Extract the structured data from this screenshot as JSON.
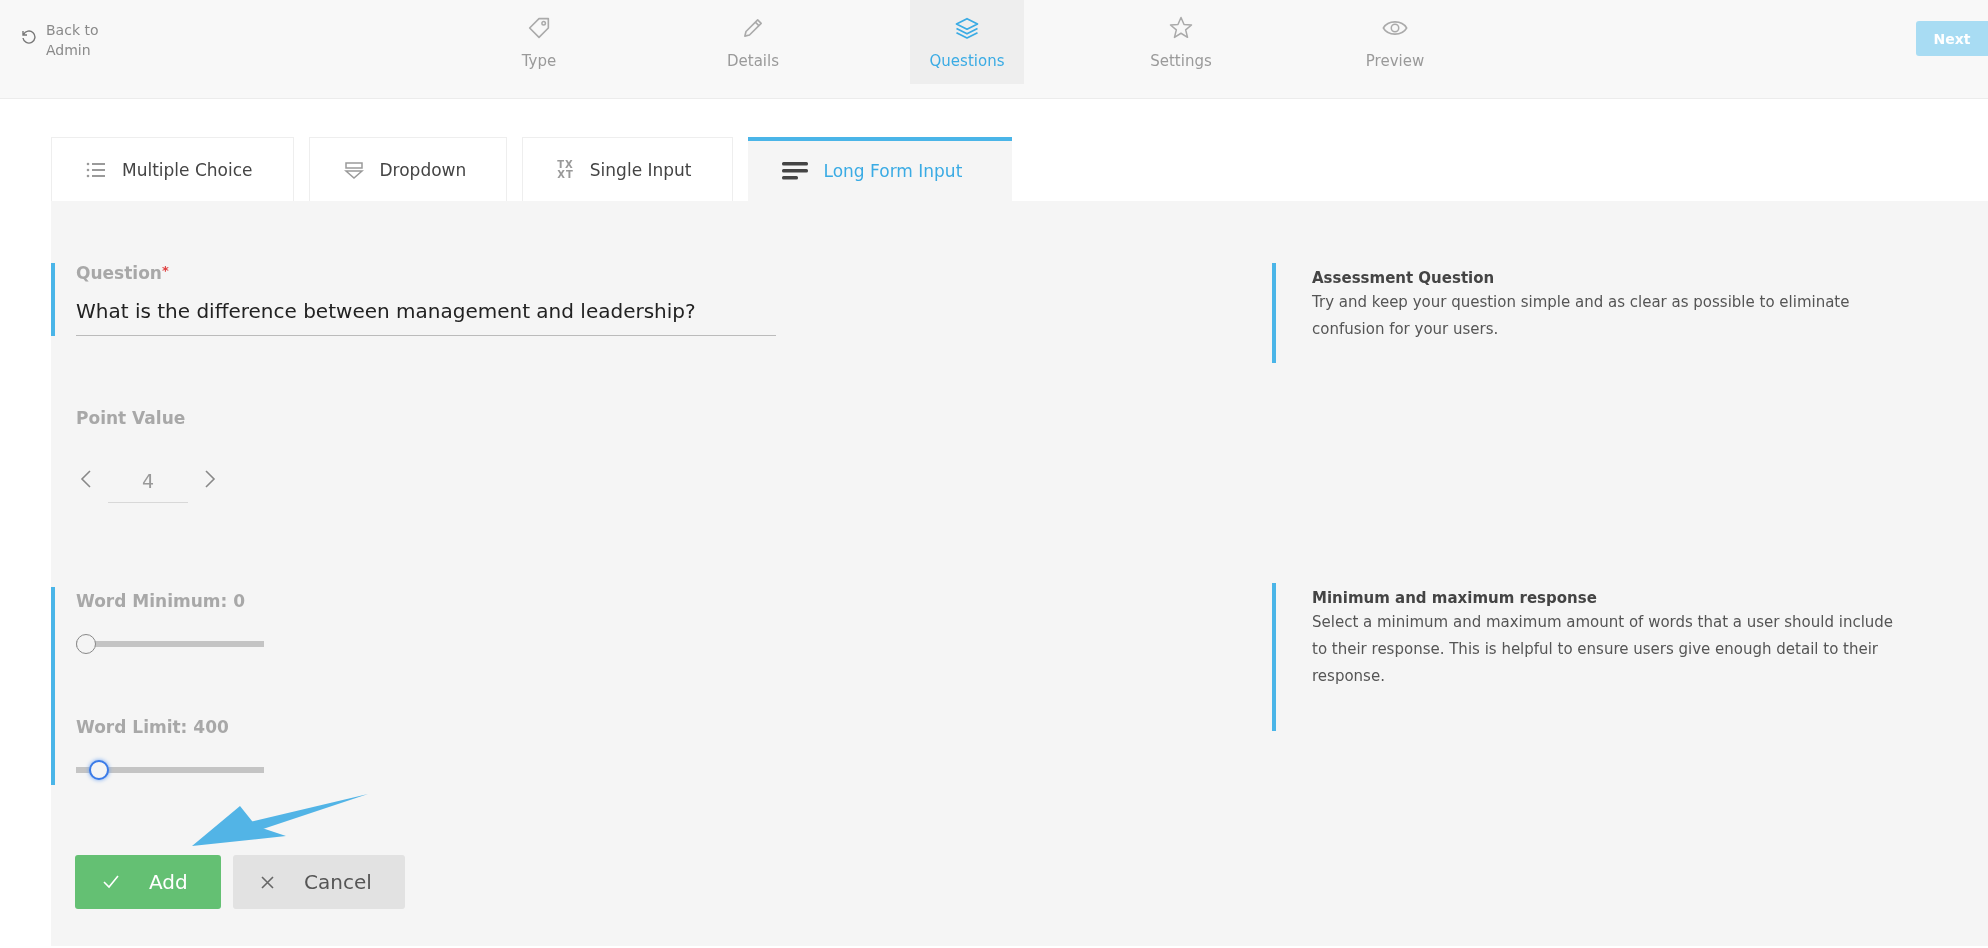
{
  "header": {
    "back_link": "Back to Admin",
    "steps": [
      {
        "label": "Type",
        "selected": false
      },
      {
        "label": "Details",
        "selected": false
      },
      {
        "label": "Questions",
        "selected": true
      },
      {
        "label": "Settings",
        "selected": false
      },
      {
        "label": "Preview",
        "selected": false
      }
    ],
    "next_button": "Next"
  },
  "question_types": [
    {
      "label": "Multiple Choice",
      "selected": false
    },
    {
      "label": "Dropdown",
      "selected": false
    },
    {
      "label": "Single Input",
      "selected": false,
      "icon_lines": [
        "TX",
        "XT"
      ]
    },
    {
      "label": "Long Form Input",
      "selected": true
    }
  ],
  "form": {
    "question": {
      "label": "Question",
      "required_mark": "*",
      "value": "What is the difference between management and leadership?"
    },
    "point_value": {
      "label": "Point Value",
      "value": "4"
    },
    "word_minimum": {
      "label": "Word Minimum: 0",
      "level": 0,
      "focused": false
    },
    "word_limit": {
      "label": "Word Limit: 400",
      "level": 0.08,
      "focused": true
    },
    "buttons": [
      {
        "kind": "add",
        "label": "Add"
      },
      {
        "kind": "cancel",
        "label": "Cancel"
      }
    ]
  },
  "help": [
    {
      "title": "Assessment Question",
      "text": "Try and keep your question simple and as clear as possible to eliminate confusion for your users."
    },
    {
      "title": "Minimum and maximum response",
      "text": "Select a minimum and maximum amount of words that a user should include to their response. This is helpful to ensure users give enough detail to their response."
    }
  ]
}
